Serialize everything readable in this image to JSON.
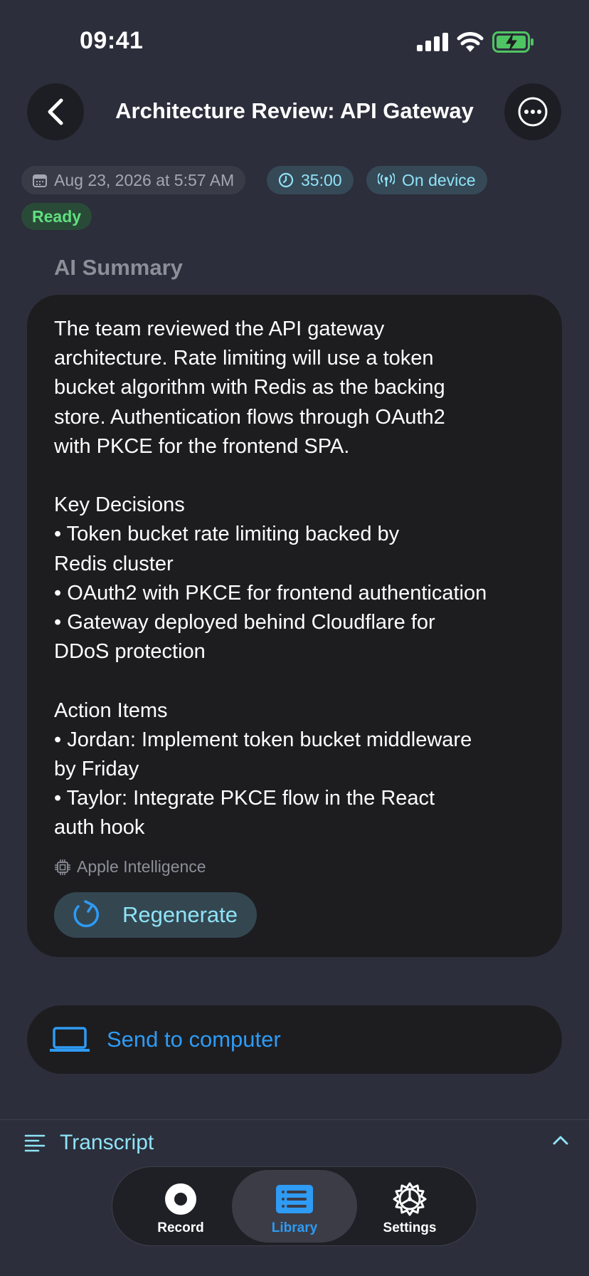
{
  "status_bar": {
    "time": "09:41"
  },
  "header": {
    "title": "Architecture Review: API Gateway"
  },
  "meta": {
    "date": "Aug 23, 2026 at 5:57 AM",
    "duration": "35:00",
    "location": "On device",
    "status": "Ready"
  },
  "summary": {
    "heading": "AI Summary",
    "text": "The team reviewed the API gateway\narchitecture. Rate limiting will use a token\nbucket algorithm with Redis as the backing\nstore. Authentication flows through OAuth2\nwith PKCE for the frontend SPA.\n\nKey Decisions\n• Token bucket rate limiting backed by\nRedis cluster\n• OAuth2 with PKCE for frontend authentication\n• Gateway deployed behind Cloudflare for\nDDoS protection\n\nAction Items\n• Jordan: Implement token bucket middleware\nby Friday\n• Taylor: Integrate PKCE flow in the React\nauth hook",
    "source": "Apple Intelligence",
    "regenerate_label": "Regenerate"
  },
  "send": {
    "label": "Send to computer"
  },
  "transcript": {
    "label": "Transcript"
  },
  "tabs": [
    {
      "label": "Record",
      "icon": "record-icon"
    },
    {
      "label": "Library",
      "icon": "library-icon",
      "selected": true
    },
    {
      "label": "Settings",
      "icon": "gear-icon"
    }
  ],
  "colors": {
    "background": "#2c2e3b",
    "card": "#1d1d20",
    "accent_blue": "#2e9bf5",
    "accent_cyan": "#8fe3f7",
    "ready_green": "#5fe07e"
  }
}
